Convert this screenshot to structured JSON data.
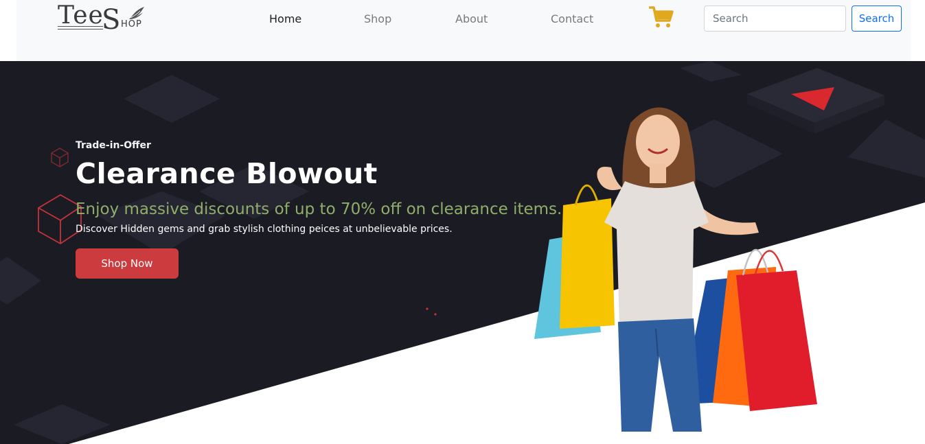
{
  "brand": {
    "name_part1": "Tee",
    "name_part2": "S",
    "name_part3": "HOP"
  },
  "nav": {
    "links": [
      {
        "label": "Home",
        "active": true
      },
      {
        "label": "Shop",
        "active": false
      },
      {
        "label": "About",
        "active": false
      },
      {
        "label": "Contact",
        "active": false
      }
    ],
    "cart_icon": "shopping-cart-icon"
  },
  "search": {
    "placeholder": "Search",
    "value": "",
    "button_label": "Search"
  },
  "hero": {
    "kicker": "Trade-in-Offer",
    "title": "Clearance Blowout",
    "subtitle": "Enjoy massive discounts of up to 70% off on clearance items.",
    "description": "Discover Hidden gems and grab stylish clothing peices at unbelievable prices.",
    "cta_label": "Shop Now"
  },
  "colors": {
    "navbar_bg": "#f8f9fa",
    "hero_dark": "#1b1b24",
    "subtitle": "#8fae6a",
    "cta": "#cc3b3e",
    "cart": "#e0a81e",
    "search_accent": "#0d6efd"
  }
}
